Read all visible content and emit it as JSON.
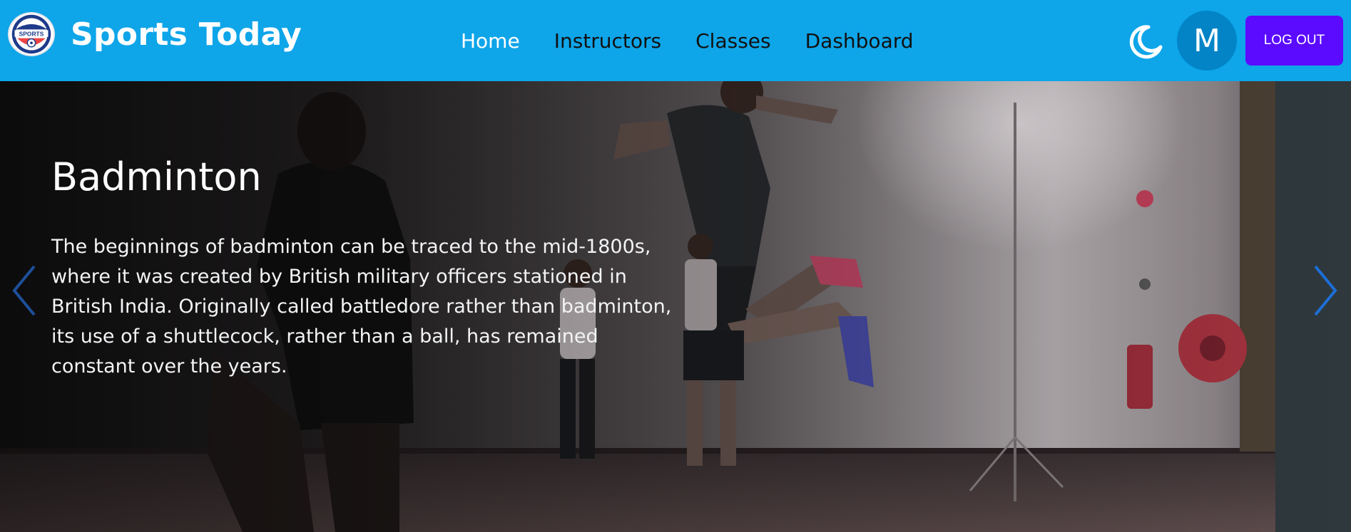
{
  "header": {
    "brand_name": "Sports Today",
    "logo_text": "SPORTS",
    "nav": [
      {
        "label": "Home",
        "active": true
      },
      {
        "label": "Instructors",
        "active": false
      },
      {
        "label": "Classes",
        "active": false
      },
      {
        "label": "Dashboard",
        "active": false
      }
    ],
    "theme_icon": "moon-icon",
    "avatar_initial": "M",
    "logout_label": "LOG OUT"
  },
  "carousel": {
    "title": "Badminton",
    "text": "The beginnings of badminton can be traced to the mid-1800s, where it was created by British military officers stationed in British India. Originally called battledore rather than badminton, its use of a shuttlecock, rather than a ball, has remained constant over the years.",
    "prev_icon": "chevron-left-icon",
    "next_icon": "chevron-right-icon"
  },
  "colors": {
    "navbar": "#0ea5e9",
    "logout": "#5b0bff",
    "avatar": "#0284c7",
    "arrow": "#1d6fd6"
  }
}
